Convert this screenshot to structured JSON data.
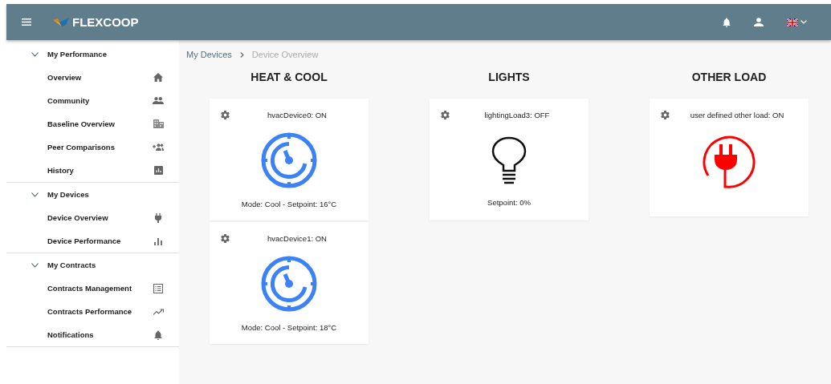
{
  "header": {
    "brand": "FLEXCOOP"
  },
  "sidebar": {
    "groups": [
      {
        "label": "My Performance",
        "expanded": true,
        "items": [
          {
            "label": "Overview"
          },
          {
            "label": "Community"
          },
          {
            "label": "Baseline Overview"
          },
          {
            "label": "Peer Comparisons"
          },
          {
            "label": "History"
          }
        ]
      },
      {
        "label": "My Devices",
        "expanded": true,
        "items": [
          {
            "label": "Device Overview"
          },
          {
            "label": "Device Performance"
          }
        ]
      },
      {
        "label": "My Contracts",
        "expanded": true,
        "items": [
          {
            "label": "Contracts Management"
          },
          {
            "label": "Contracts Performance"
          },
          {
            "label": "Notifications"
          }
        ]
      }
    ]
  },
  "breadcrumb": [
    "My Devices",
    "Device Overview"
  ],
  "columns": [
    {
      "title": "HEAT & COOL",
      "devices": [
        {
          "kind": "hvac",
          "name": "hvacDevice0: ON",
          "detail": "Mode: Cool - Setpoint: 16°C"
        },
        {
          "kind": "hvac",
          "name": "hvacDevice1: ON",
          "detail": "Mode: Cool - Setpoint: 18°C"
        }
      ]
    },
    {
      "title": "LIGHTS",
      "devices": [
        {
          "kind": "lighting",
          "name": "lightingLoad3: OFF",
          "detail": "Setpoint: 0%"
        }
      ]
    },
    {
      "title": "OTHER LOAD",
      "devices": [
        {
          "kind": "other",
          "name": "user defined other load: ON"
        }
      ]
    }
  ]
}
